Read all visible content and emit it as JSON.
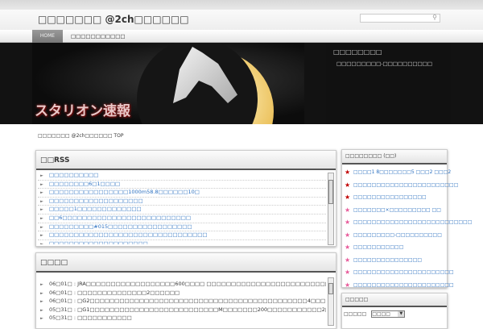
{
  "site": {
    "title": "□□□□□□□ @2ch□□□□□□",
    "search_placeholder": "",
    "nav": [
      "HOME",
      "□□□□□□□□□□□"
    ],
    "logo": "スタリオン速報",
    "banner_side_title": "□□□□□□□□",
    "banner_side_text": "□□□□□□□□□-□□□□□□□□□□",
    "breadcrumb": "□□□□□□□ @2ch□□□□□□ TOP"
  },
  "rss": {
    "title": "□□RSS",
    "items": [
      "□□□□□□□□□□",
      "□□□□□□□□6□1□□□□",
      "□□□□□□□□□□□□□□□□1000m58.8□□□□□□10□",
      "□□□□□□□□□□□□□□□□□□□",
      "□□□□□1□□□□□□□□□□□□□",
      "□□6□□□□□□□□□□□□□□□□□□□□□□□□□□",
      "□□□□□□□□□#015□□□□□□□□□□□□□□□□□",
      "□□□□□□□□□□□□□□□□□□□□□□□□□□□□□□□□",
      "□□□□□□□□□□□□□□□□□□□□"
    ]
  },
  "recent": {
    "title": "□□□□",
    "items": [
      {
        "date": "06□01□ : ",
        "text": "JRA□□□□□□□□□□□□□□□□□□600□□□□ □□□□□□□□□□□□□□□□□□□□□□□□□□□□□□□□□□"
      },
      {
        "date": "06□01□ : ",
        "text": "□□□□□□□□□□□□□□2□□□□□□"
      },
      {
        "date": "06□01□ : ",
        "text": "□G2□□□□□□□□□□□□□□□□□□□□□□□□□□□□□□□□□□□□□□□□□□□□4□□□"
      },
      {
        "date": "05□31□ : ",
        "text": "□G1□□□□□□□□□□□□□□□□□□□□□□□□□□M□□□□□□□200□□□□□□□□□□□2□□□□"
      },
      {
        "date": "05□31□ : ",
        "text": "□□□□□□□□□□□"
      }
    ]
  },
  "ranking": {
    "title": "□□□□□□□□ (□□)",
    "items": [
      "□□□□1 8□□□□□□□5 □□□2 □□□2",
      "□□□□□□□□□□□□□□□□□□□□□□□",
      "□□□□□□□□□□□□□□□□",
      "□□□□□□□×□□□□□□□□□ □□",
      "□□□□□□□□□□□□□□□□□□□□□□□□□□",
      "□□□□□□□□□-□□□□□□□□□□",
      "□□□□□□□□□□□",
      "□□□□□□□□□□□□□□□",
      "□□□□□□□□□□□□□□□□□□□□□□",
      "□□□□□□□□□□□□□□□□□□□□□□"
    ],
    "star_colors": [
      "#c00000",
      "#c00000",
      "#c00000",
      "#e85a9a",
      "#e85a9a",
      "#e85a9a",
      "#e85a9a",
      "#e85a9a",
      "#e85a9a",
      "#e85a9a"
    ]
  },
  "archive": {
    "title": "□□□□□",
    "label": "□□□□□",
    "select": "□□□□"
  }
}
